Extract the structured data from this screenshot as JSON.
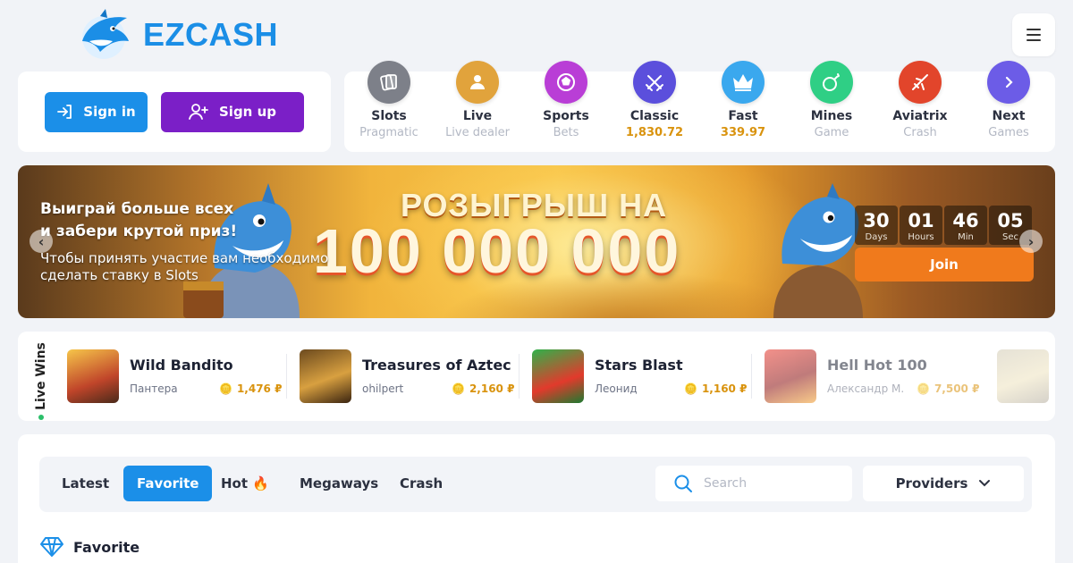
{
  "header": {
    "logo_text": "EZCASH",
    "menu_icon": "hamburger-menu-icon"
  },
  "auth": {
    "signin_label": "Sign in",
    "signup_label": "Sign up"
  },
  "categories": [
    {
      "name": "Slots",
      "sub": "Pragmatic",
      "icon": "cards-icon",
      "color": "#7d8089"
    },
    {
      "name": "Live",
      "sub": "Live dealer",
      "icon": "dealer-icon",
      "color": "#e1a33c"
    },
    {
      "name": "Sports",
      "sub": "Bets",
      "icon": "soccer-ball-icon",
      "color": "#b93ed6"
    },
    {
      "name": "Classic",
      "sub": "1,830.72",
      "icon": "crossed-swords-icon",
      "color": "#5b4fdc"
    },
    {
      "name": "Fast",
      "sub": "339.97",
      "icon": "crown-icon",
      "color": "#3aa8ee"
    },
    {
      "name": "Mines",
      "sub": "Game",
      "icon": "bomb-icon",
      "color": "#2fcf85"
    },
    {
      "name": "Aviatrix",
      "sub": "Crash",
      "icon": "plane-icon",
      "color": "#e2452b"
    },
    {
      "name": "Next",
      "sub": "Games",
      "icon": "chevron-right-icon",
      "color": "#6c5ce7"
    }
  ],
  "banner": {
    "title_line1": "Выиграй больше всех",
    "title_line2": "и забери крутой приз!",
    "subtitle_line1": "Чтобы принять участие вам необходимо",
    "subtitle_line2": "сделать ставку в Slots",
    "headline": "РОЗЫГРЫШ НА",
    "amount": "100 000 000",
    "timer": [
      {
        "value": "30",
        "label": "Days"
      },
      {
        "value": "01",
        "label": "Hours"
      },
      {
        "value": "46",
        "label": "Min"
      },
      {
        "value": "05",
        "label": "Sec"
      }
    ],
    "join_label": "Join"
  },
  "live_wins": {
    "label": "Live Wins",
    "items": [
      {
        "game": "Wild Bandito",
        "user": "Пантера",
        "amount": "1,476 ₽"
      },
      {
        "game": "Treasures of Aztec",
        "user": "ohilpert",
        "amount": "2,160 ₽"
      },
      {
        "game": "Stars Blast",
        "user": "Леонид",
        "amount": "1,160 ₽"
      },
      {
        "game": "Hell Hot 100",
        "user": "Александр М.",
        "amount": "7,500 ₽"
      }
    ]
  },
  "games": {
    "tabs": [
      "Latest",
      "Favorite",
      "Hot 🔥",
      "Megaways",
      "Crash"
    ],
    "active_tab": "Favorite",
    "search_placeholder": "Search",
    "providers_label": "Providers",
    "section_title": "Favorite"
  },
  "colors": {
    "primary_blue": "#1b8fe8",
    "purple": "#7b1fc7",
    "gold": "#d9930e",
    "orange": "#f07a1c",
    "background": "#f1f3f7"
  }
}
